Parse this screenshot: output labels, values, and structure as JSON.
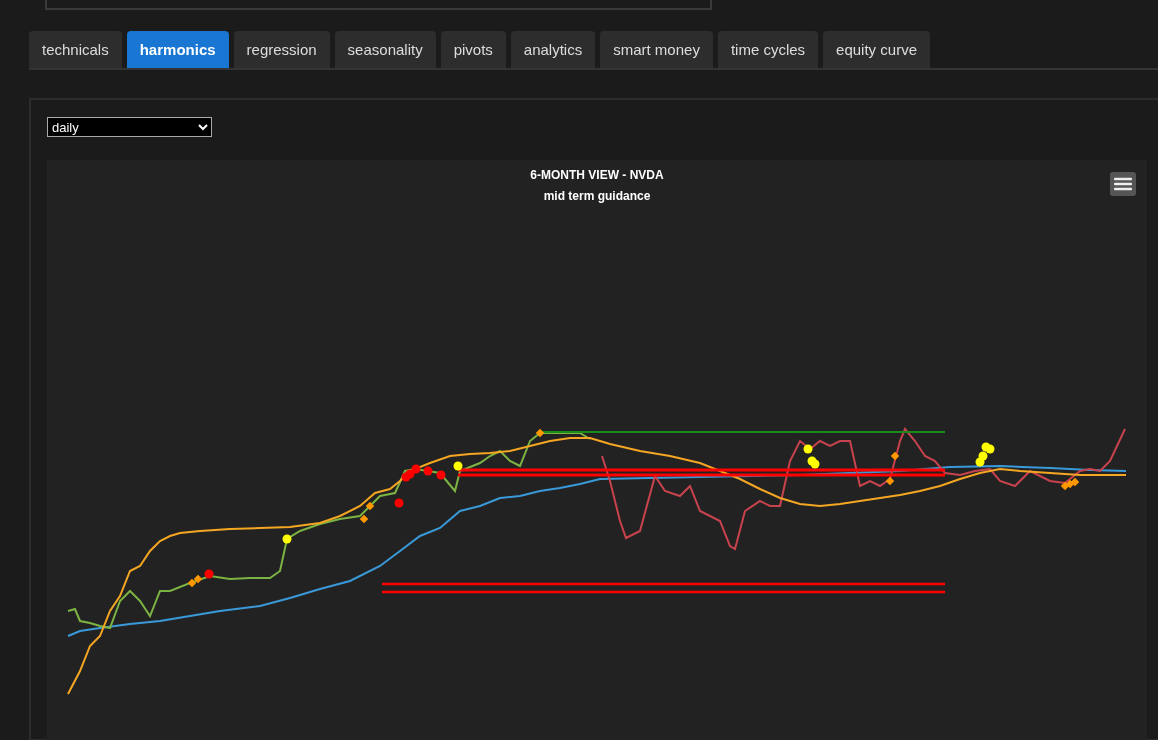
{
  "tabs": [
    {
      "label": "technicals",
      "selected": false
    },
    {
      "label": "harmonics",
      "selected": true
    },
    {
      "label": "regression",
      "selected": false
    },
    {
      "label": "seasonality",
      "selected": false
    },
    {
      "label": "pivots",
      "selected": false
    },
    {
      "label": "analytics",
      "selected": false
    },
    {
      "label": "smart money",
      "selected": false
    },
    {
      "label": "time cycles",
      "selected": false
    },
    {
      "label": "equity curve",
      "selected": false
    }
  ],
  "timeframe": {
    "value": "daily"
  },
  "chart": {
    "title": "6-MONTH VIEW - NVDA",
    "subtitle": "mid term guidance"
  }
}
